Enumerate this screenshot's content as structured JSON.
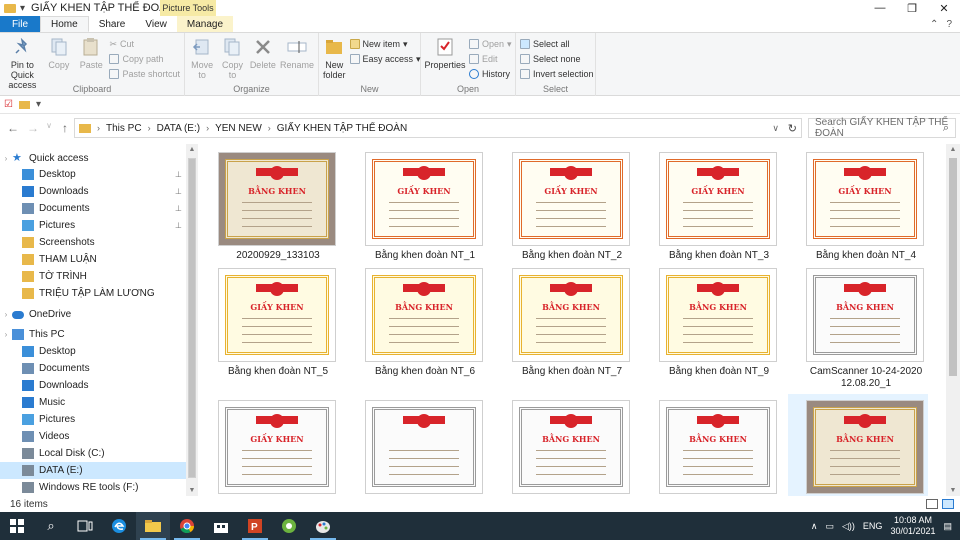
{
  "window": {
    "title": "GIẤY KHEN TẬP THỂ ĐOÀN",
    "context_tab_header": "Picture Tools",
    "controls": [
      "—",
      "❐",
      "✕"
    ]
  },
  "tabs": [
    {
      "label": "File"
    },
    {
      "label": "Home"
    },
    {
      "label": "Share"
    },
    {
      "label": "View"
    },
    {
      "label": "Manage"
    }
  ],
  "ribbon": {
    "clipboard": {
      "label": "Clipboard",
      "pin": "Pin to Quick access",
      "copy": "Copy",
      "paste": "Paste",
      "cut": "Cut",
      "copy_path": "Copy path",
      "paste_shortcut": "Paste shortcut"
    },
    "organize": {
      "label": "Organize",
      "move_to": "Move to",
      "copy_to": "Copy to",
      "delete": "Delete",
      "rename": "Rename"
    },
    "new": {
      "label": "New",
      "new_folder": "New folder",
      "new_item": "New item",
      "easy_access": "Easy access"
    },
    "open": {
      "label": "Open",
      "properties": "Properties",
      "open": "Open",
      "edit": "Edit",
      "history": "History"
    },
    "select": {
      "label": "Select",
      "select_all": "Select all",
      "select_none": "Select none",
      "invert": "Invert selection"
    }
  },
  "address": {
    "crumbs": [
      "This PC",
      "DATA (E:)",
      "YEN NEW",
      "GIẤY KHEN TẬP THỂ ĐOÀN"
    ],
    "search_placeholder": "Search GIẤY KHEN TẬP THỂ ĐOÀN"
  },
  "nav": {
    "items": [
      {
        "label": "Quick access",
        "icon": "star-icon",
        "level": 0
      },
      {
        "label": "Desktop",
        "icon": "desktop-icon",
        "level": 1,
        "pinned": true
      },
      {
        "label": "Downloads",
        "icon": "downloads-icon",
        "level": 1,
        "pinned": true
      },
      {
        "label": "Documents",
        "icon": "documents-icon",
        "level": 1,
        "pinned": true
      },
      {
        "label": "Pictures",
        "icon": "pictures-icon",
        "level": 1,
        "pinned": true
      },
      {
        "label": "Screenshots",
        "icon": "folder-icon",
        "level": 1
      },
      {
        "label": "THAM LUẬN",
        "icon": "folder-icon",
        "level": 1
      },
      {
        "label": "TỜ TRÌNH",
        "icon": "folder-icon",
        "level": 1
      },
      {
        "label": "TRIỆU TẬP LÀM LƯƠNG",
        "icon": "folder-icon",
        "level": 1
      },
      {
        "label": "OneDrive",
        "icon": "cloud-icon",
        "level": 0
      },
      {
        "label": "This PC",
        "icon": "computer-icon",
        "level": 0
      },
      {
        "label": "Desktop",
        "icon": "desktop-icon",
        "level": 1
      },
      {
        "label": "Documents",
        "icon": "documents-icon",
        "level": 1
      },
      {
        "label": "Downloads",
        "icon": "downloads-icon",
        "level": 1
      },
      {
        "label": "Music",
        "icon": "music-icon",
        "level": 1
      },
      {
        "label": "Pictures",
        "icon": "pictures-icon",
        "level": 1
      },
      {
        "label": "Videos",
        "icon": "videos-icon",
        "level": 1
      },
      {
        "label": "Local Disk (C:)",
        "icon": "drive-icon",
        "level": 1
      },
      {
        "label": "DATA (E:)",
        "icon": "drive-icon",
        "level": 1,
        "selected": true
      },
      {
        "label": "Windows RE tools (F:)",
        "icon": "drive-icon",
        "level": 1
      }
    ]
  },
  "files": [
    {
      "name": "20200929_133103",
      "style": "photo",
      "title": "BẰNG KHEN"
    },
    {
      "name": "Bằng khen đoàn NT_1",
      "style": "red",
      "title": "GIẤY KHEN"
    },
    {
      "name": "Bằng khen đoàn NT_2",
      "style": "red",
      "title": "GIẤY KHEN"
    },
    {
      "name": "Bằng khen đoàn NT_3",
      "style": "red",
      "title": "GIẤY KHEN"
    },
    {
      "name": "Bằng khen đoàn NT_4",
      "style": "red",
      "title": "GIẤY KHEN"
    },
    {
      "name": "Bằng khen đoàn NT_5",
      "style": "yellow",
      "title": "GIẤY KHEN"
    },
    {
      "name": "Bằng khen đoàn NT_6",
      "style": "yellow",
      "title": "BẰNG KHEN"
    },
    {
      "name": "Bằng khen đoàn NT_7",
      "style": "yellow",
      "title": "BẰNG KHEN"
    },
    {
      "name": "Bằng khen đoàn NT_9",
      "style": "yellow",
      "title": "BẰNG KHEN"
    },
    {
      "name": "CamScanner 10-24-2020 12.08.20_1",
      "style": "gray",
      "title": "BẰNG KHEN"
    },
    {
      "name": "",
      "style": "gray",
      "title": "GIẤY KHEN"
    },
    {
      "name": "",
      "style": "gray",
      "title": ""
    },
    {
      "name": "",
      "style": "gray",
      "title": "BẰNG KHEN"
    },
    {
      "name": "",
      "style": "gray",
      "title": "BẰNG KHEN"
    },
    {
      "name": "",
      "style": "photo",
      "title": "BẰNG KHEN",
      "selected": true
    }
  ],
  "status": {
    "item_count": "16 items"
  },
  "taskbar": {
    "lang": "ENG",
    "time": "10:08 AM",
    "date": "30/01/2021"
  },
  "colors": {
    "accent": "#1979ca",
    "selection": "#cce8ff",
    "taskbar": "#1f2f3a",
    "certificate_red": "#d8242a"
  }
}
